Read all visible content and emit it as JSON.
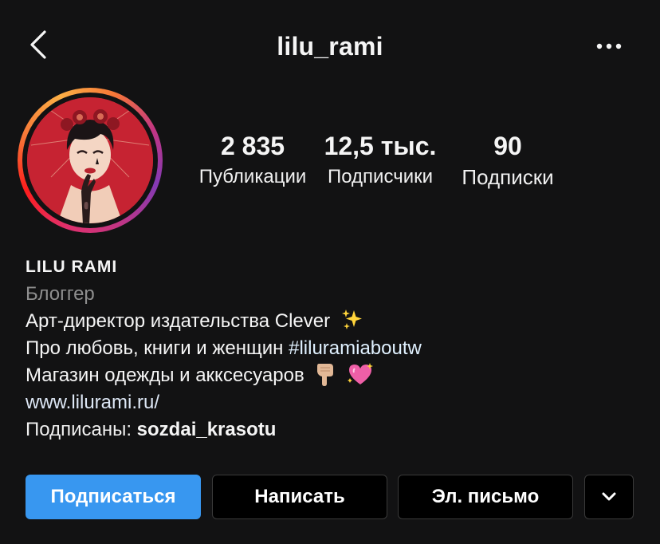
{
  "header": {
    "title": "lilu_rami",
    "back_icon": "chevron-left-icon",
    "more_icon": "more-horizontal-icon"
  },
  "profile": {
    "avatar_icon": "profile-avatar",
    "stats": [
      {
        "value": "2 835",
        "label": "Публикации"
      },
      {
        "value": "12,5 тыс.",
        "label": "Подписчики"
      },
      {
        "value": "90",
        "label": "Подписки"
      }
    ]
  },
  "bio": {
    "name": "LILU RAMI",
    "category": "Блоггер",
    "line1": "Арт-директор издательства Clever",
    "line2_text": "Про любовь, книги и женщин ",
    "line2_hashtag": "#liluramiaboutw",
    "line3": "Магазин одежды и акксесуаров",
    "link": "www.lilurami.ru/",
    "followed_by_label": "Подписаны: ",
    "followed_by_user": "sozdai_krasotu",
    "emoji_line1": "sparkles-emoji",
    "emoji_line3": [
      "pointing-down-emoji",
      "sparkling-heart-emoji"
    ]
  },
  "actions": {
    "follow": "Подписаться",
    "message": "Написать",
    "email": "Эл. письмо",
    "more_icon": "chevron-down-icon"
  },
  "colors": {
    "background": "#121213",
    "primary_button": "#3897f0",
    "secondary_text": "#8e8e8e"
  }
}
